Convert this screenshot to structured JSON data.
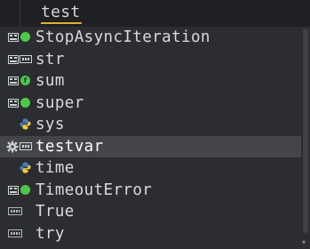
{
  "editor": {
    "typed_text": "test"
  },
  "completion": {
    "selected_index": 5,
    "items": [
      {
        "label": "StopAsyncIteration",
        "icon": "class-icon",
        "kind": "class"
      },
      {
        "label": "str",
        "icon": "class-parameter-icon",
        "kind": "class-param"
      },
      {
        "label": "sum",
        "icon": "function-icon",
        "kind": "function"
      },
      {
        "label": "super",
        "icon": "class-icon",
        "kind": "class"
      },
      {
        "label": "sys",
        "icon": "python-module-icon",
        "kind": "module"
      },
      {
        "label": "testvar",
        "icon": "variable-icon",
        "kind": "variable"
      },
      {
        "label": "time",
        "icon": "python-module-icon",
        "kind": "module"
      },
      {
        "label": "TimeoutError",
        "icon": "class-icon",
        "kind": "class"
      },
      {
        "label": "True",
        "icon": "keyword-icon",
        "kind": "keyword"
      },
      {
        "label": "try",
        "icon": "keyword-icon",
        "kind": "keyword"
      }
    ]
  },
  "colors": {
    "class_dot": "#4cc74c",
    "function_dot": "#4cc74c",
    "selection": "#43454a",
    "underline": "#d9b52a"
  }
}
